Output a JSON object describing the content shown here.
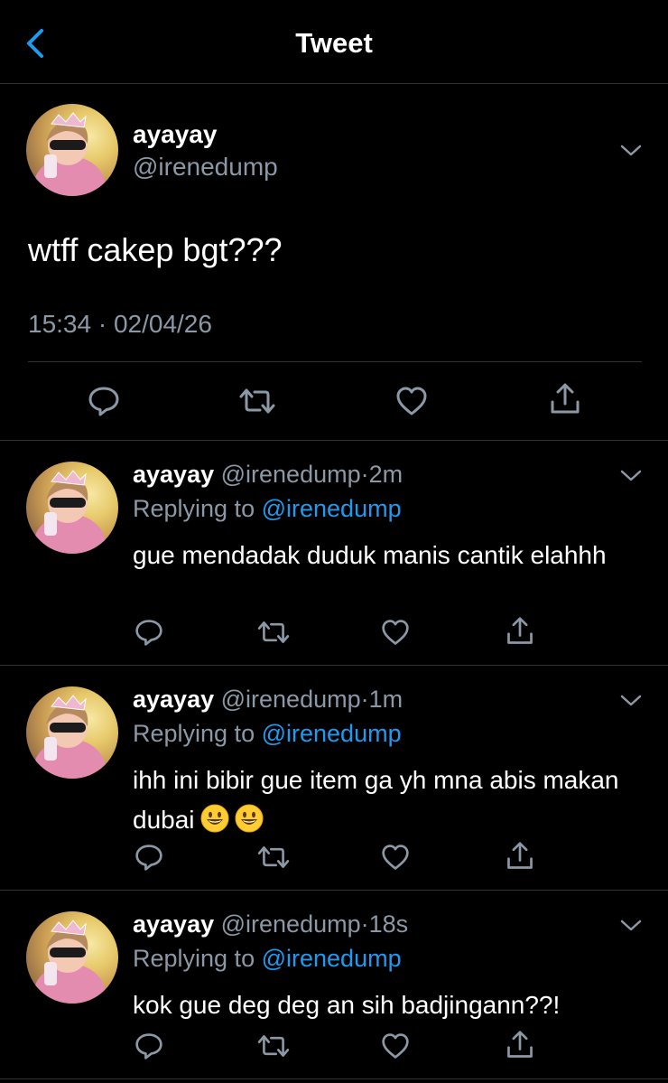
{
  "header": {
    "title": "Tweet",
    "back_icon": "chevron-left-icon",
    "accent_color": "#1d9bf0"
  },
  "main_tweet": {
    "name": "ayayay",
    "handle": "@irenedump",
    "text": "wtff cakep bgt???",
    "meta": "15:34 · 02/04/26"
  },
  "replies": [
    {
      "name": "ayayay",
      "handle": "@irenedump",
      "dot": "·",
      "time": "2m",
      "replying_prefix": "Replying to",
      "replying_to": "@irenedump",
      "text": "gue mendadak duduk manis cantik elahhh"
    },
    {
      "name": "ayayay",
      "handle": "@irenedump",
      "dot": "·",
      "time": "1m",
      "replying_prefix": "Replying to",
      "replying_to": "@irenedump",
      "text": "ihh ini bibir gue item ga yh mna abis makan dubai",
      "emojis": [
        "grinning-face-icon",
        "grinning-face-icon"
      ]
    },
    {
      "name": "ayayay",
      "handle": "@irenedump",
      "dot": "·",
      "time": "18s",
      "replying_prefix": "Replying to",
      "replying_to": "@irenedump",
      "text": "kok gue deg deg an sih badjingann??!"
    }
  ],
  "actions": [
    "reply-icon",
    "retweet-icon",
    "like-icon",
    "share-icon"
  ],
  "colors": {
    "background": "#000000",
    "secondary_text": "#8b98a5",
    "divider": "#2f3336",
    "link": "#1d9bf0"
  }
}
